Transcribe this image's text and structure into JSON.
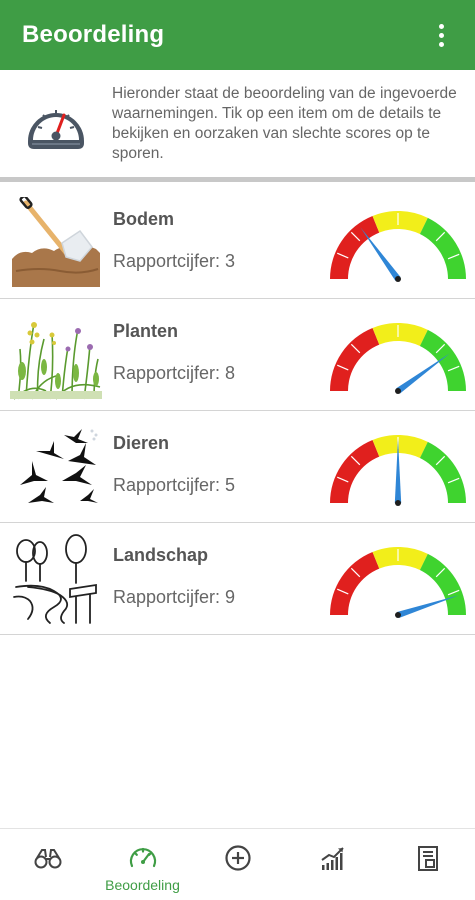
{
  "appbar": {
    "title": "Beoordeling",
    "menu_icon": "more-vert-icon"
  },
  "intro": {
    "icon": "speedometer-icon",
    "text": "Hieronder staat de beoordeling van de ingevoerde waarnemingen. Tik op een item om de details te bekijken en oorzaken van slechte scores op te sporen."
  },
  "items": [
    {
      "name": "Bodem",
      "score_text": "Rapportcijfer: 3",
      "score": 3,
      "icon": "soil-shovel-icon"
    },
    {
      "name": "Planten",
      "score_text": "Rapportcijfer: 8",
      "score": 8,
      "icon": "plants-icon"
    },
    {
      "name": "Dieren",
      "score_text": "Rapportcijfer: 5",
      "score": 5,
      "icon": "birds-icon"
    },
    {
      "name": "Landschap",
      "score_text": "Rapportcijfer: 9",
      "score": 9,
      "icon": "landscape-icon"
    }
  ],
  "gauge_colors": {
    "red": "#e0201e",
    "yellow": "#f2ee1a",
    "green": "#3fd32f",
    "needle": "#2f86d6"
  },
  "bottom_nav": [
    {
      "icon": "binoculars-icon",
      "label": ""
    },
    {
      "icon": "speedometer-icon",
      "label": "Beoordeling",
      "active": true
    },
    {
      "icon": "add-circle-icon",
      "label": ""
    },
    {
      "icon": "trend-chart-icon",
      "label": ""
    },
    {
      "icon": "report-icon",
      "label": ""
    }
  ],
  "theme": {
    "primary": "#3f9d45"
  }
}
